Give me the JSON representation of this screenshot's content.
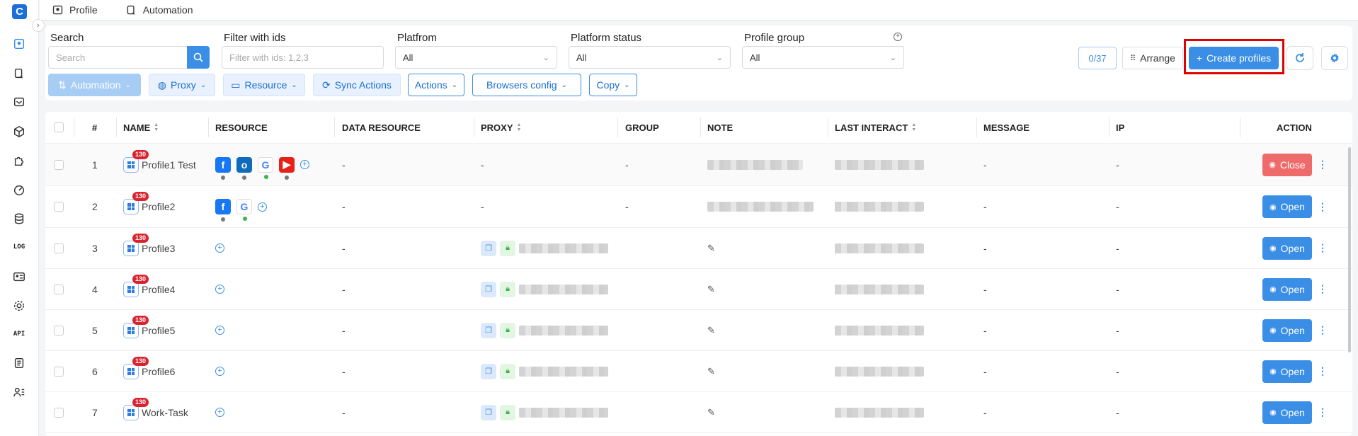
{
  "app": {
    "logo_letter": "C"
  },
  "topbar": {
    "tabs": [
      {
        "label": "Profile"
      },
      {
        "label": "Automation"
      }
    ]
  },
  "sidebar": {
    "log_label": "LOG",
    "api_label": "API"
  },
  "filters": {
    "search": {
      "label": "Search",
      "placeholder": "Search"
    },
    "ids": {
      "label": "Filter with ids",
      "placeholder": "Filter with ids: 1,2,3"
    },
    "platform": {
      "label": "Platfrom",
      "value": "All"
    },
    "platform_status": {
      "label": "Platform status",
      "value": "All"
    },
    "profile_group": {
      "label": "Profile group",
      "value": "All"
    },
    "count": "0/37",
    "arrange_label": "Arrange",
    "create_label": "Create profiles"
  },
  "toolbar": {
    "automation": "Automation",
    "proxy": "Proxy",
    "resource": "Resource",
    "sync": "Sync Actions",
    "actions": "Actions",
    "browsers_config": "Browsers config",
    "copy": "Copy"
  },
  "table": {
    "headers": {
      "num": "#",
      "name": "NAME",
      "resource": "RESOURCE",
      "data_resource": "DATA RESOURCE",
      "proxy": "PROXY",
      "group": "GROUP",
      "note": "NOTE",
      "last_interact": "LAST INTERACT",
      "message": "MESSAGE",
      "ip": "IP",
      "action": "ACTION"
    },
    "rows": [
      {
        "num": "1",
        "name": "Profile1 Test",
        "badge": "130",
        "data_resource": "-",
        "proxy": "-",
        "group": "-",
        "message": "-",
        "ip": "-",
        "action": "Close"
      },
      {
        "num": "2",
        "name": "Profile2",
        "badge": "130",
        "data_resource": "-",
        "proxy": "-",
        "group": "-",
        "message": "-",
        "ip": "-",
        "action": "Open"
      },
      {
        "num": "3",
        "name": "Profile3",
        "badge": "130",
        "data_resource": "-",
        "message": "-",
        "ip": "-",
        "action": "Open"
      },
      {
        "num": "4",
        "name": "Profile4",
        "badge": "130",
        "data_resource": "-",
        "message": "-",
        "ip": "-",
        "action": "Open"
      },
      {
        "num": "5",
        "name": "Profile5",
        "badge": "130",
        "data_resource": "-",
        "message": "-",
        "ip": "-",
        "action": "Open"
      },
      {
        "num": "6",
        "name": "Profile6",
        "badge": "130",
        "data_resource": "-",
        "message": "-",
        "ip": "-",
        "action": "Open"
      },
      {
        "num": "7",
        "name": "Work-Task",
        "badge": "130",
        "data_resource": "-",
        "message": "-",
        "ip": "-",
        "action": "Open"
      }
    ]
  },
  "colors": {
    "primary": "#3a8ee6",
    "close": "#ef6b6b",
    "badge": "#d9242f",
    "highlight": "#e00000"
  }
}
